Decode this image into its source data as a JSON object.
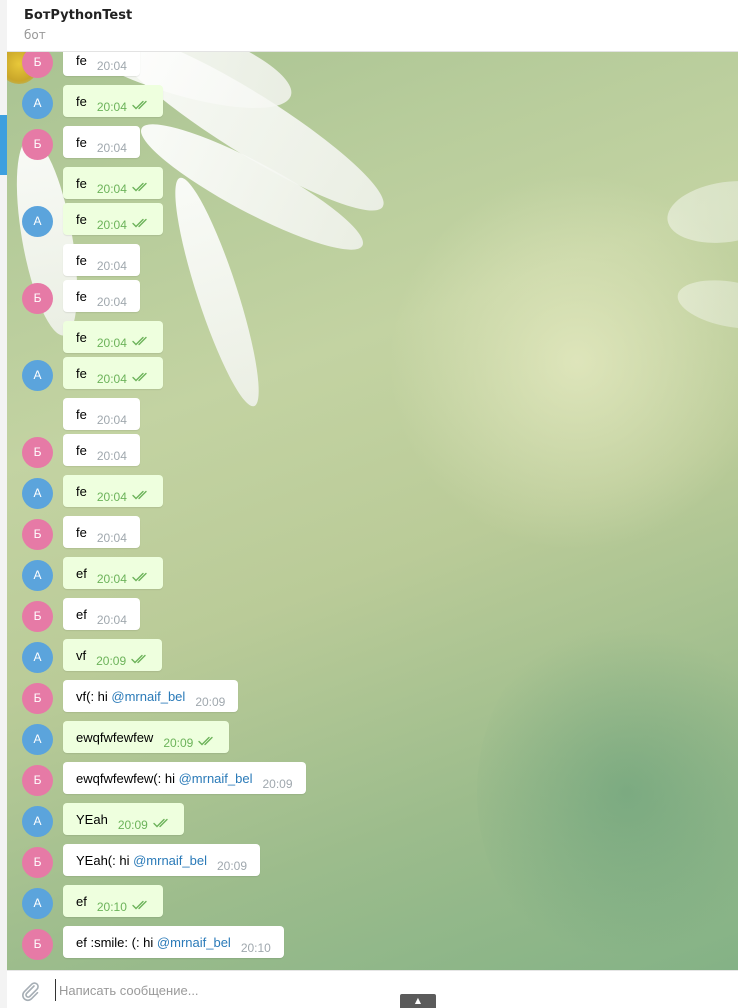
{
  "header": {
    "title": "БотPythonTest",
    "subtitle": "бот"
  },
  "colors": {
    "bot_avatar": "#e67aa6",
    "user_avatar": "#5ba4dc",
    "incoming_bubble": "#ffffff",
    "outgoing_bubble": "#eeffde",
    "read_check": "#6cb35a",
    "mention": "#2a7ab8"
  },
  "messages": [
    {
      "avatar": "Б",
      "out": false,
      "text": "fe",
      "time": "20:04"
    },
    {
      "avatar": "A",
      "out": true,
      "text": "fe",
      "time": "20:04"
    },
    {
      "avatar": "Б",
      "out": false,
      "text": "fe",
      "time": "20:04"
    },
    {
      "avatar": "",
      "out": true,
      "text": "fe",
      "time": "20:04"
    },
    {
      "avatar": "A",
      "out": true,
      "text": "fe",
      "time": "20:04"
    },
    {
      "avatar": "",
      "out": false,
      "text": "fe",
      "time": "20:04"
    },
    {
      "avatar": "Б",
      "out": false,
      "text": "fe",
      "time": "20:04"
    },
    {
      "avatar": "",
      "out": true,
      "text": "fe",
      "time": "20:04"
    },
    {
      "avatar": "A",
      "out": true,
      "text": "fe",
      "time": "20:04"
    },
    {
      "avatar": "",
      "out": false,
      "text": "fe",
      "time": "20:04"
    },
    {
      "avatar": "Б",
      "out": false,
      "text": "fe",
      "time": "20:04"
    },
    {
      "avatar": "A",
      "out": true,
      "text": "fe",
      "time": "20:04"
    },
    {
      "avatar": "Б",
      "out": false,
      "text": "fe",
      "time": "20:04"
    },
    {
      "avatar": "A",
      "out": true,
      "text": "ef",
      "time": "20:04"
    },
    {
      "avatar": "Б",
      "out": false,
      "text": "ef",
      "time": "20:04"
    },
    {
      "avatar": "A",
      "out": true,
      "text": "vf",
      "time": "20:09"
    },
    {
      "avatar": "Б",
      "out": false,
      "text": "vf(: hi ",
      "mention": "@mrnaif_bel",
      "time": "20:09"
    },
    {
      "avatar": "A",
      "out": true,
      "text": "ewqfwfewfew",
      "time": "20:09"
    },
    {
      "avatar": "Б",
      "out": false,
      "text": "ewqfwfewfew(: hi ",
      "mention": "@mrnaif_bel",
      "time": "20:09"
    },
    {
      "avatar": "A",
      "out": true,
      "text": "YEah",
      "time": "20:09"
    },
    {
      "avatar": "Б",
      "out": false,
      "text": "YEah(: hi ",
      "mention": "@mrnaif_bel",
      "time": "20:09"
    },
    {
      "avatar": "A",
      "out": true,
      "text": "ef",
      "time": "20:10"
    },
    {
      "avatar": "Б",
      "out": false,
      "text": "ef :smile: (: hi ",
      "mention": "@mrnaif_bel",
      "time": "20:10"
    }
  ],
  "composer": {
    "placeholder": "Написать сообщение...",
    "attach_icon": "paperclip-icon",
    "scroll_icon": "arrow-up-icon"
  }
}
